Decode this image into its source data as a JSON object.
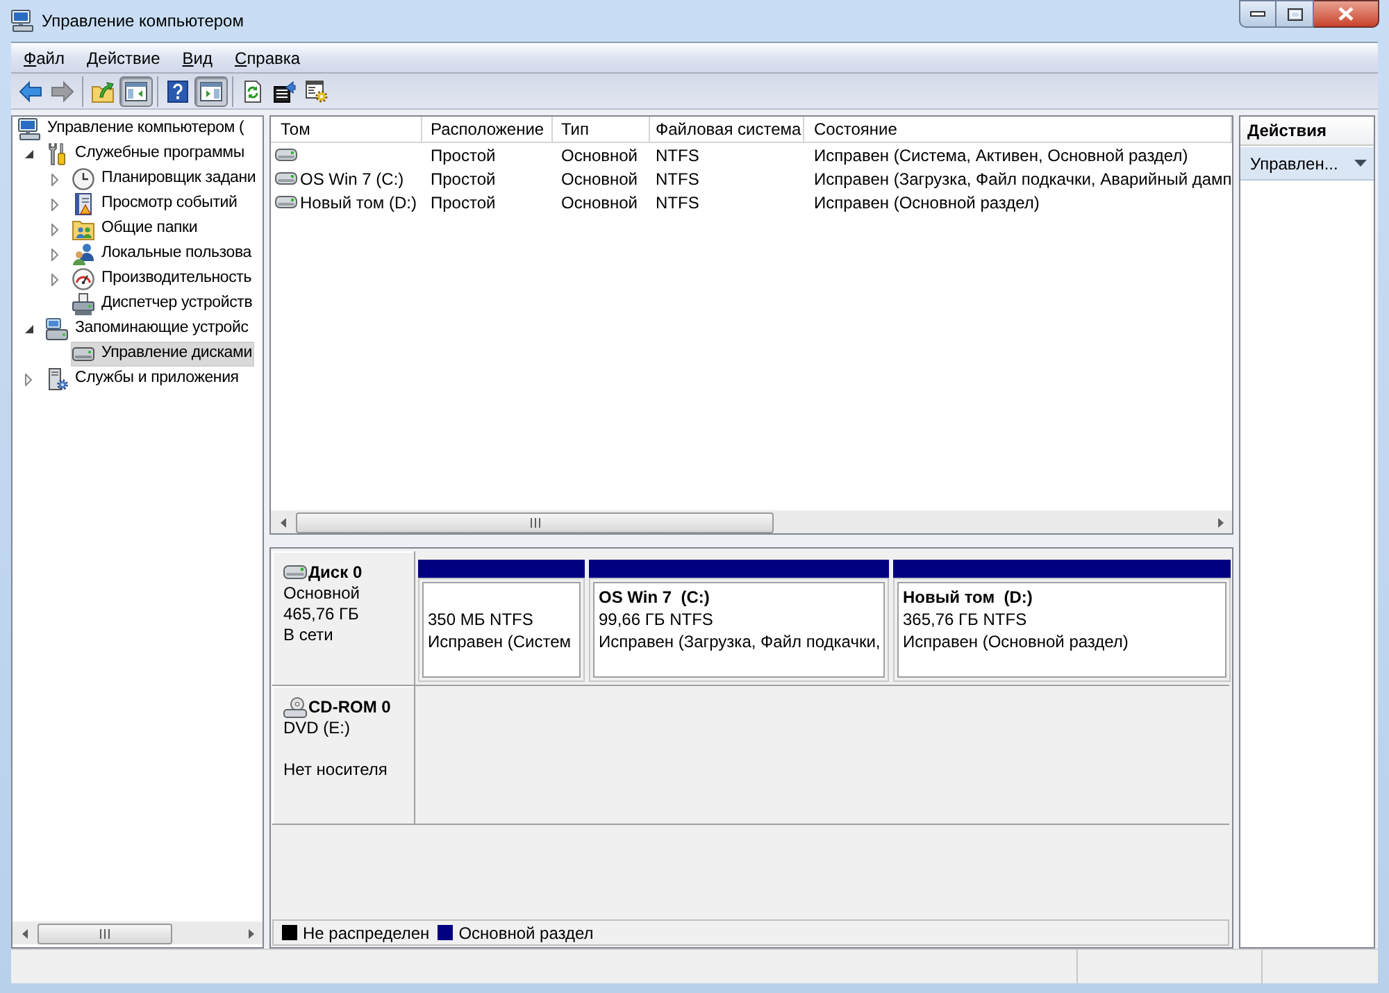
{
  "window": {
    "title": "Управление компьютером"
  },
  "menu": [
    {
      "label": "Файл"
    },
    {
      "label": "Действие"
    },
    {
      "label": "Вид"
    },
    {
      "label": "Справка"
    }
  ],
  "toolbar": [
    [
      {
        "kind": "back",
        "disabled": false,
        "pressed": false
      },
      {
        "kind": "forward",
        "disabled": true,
        "pressed": false
      }
    ],
    [
      {
        "kind": "up",
        "disabled": false,
        "pressed": false
      },
      {
        "kind": "console-tree",
        "disabled": false,
        "pressed": true
      }
    ],
    [
      {
        "kind": "help",
        "disabled": false,
        "pressed": false
      },
      {
        "kind": "action-pane",
        "disabled": false,
        "pressed": true
      }
    ],
    [
      {
        "kind": "refresh",
        "disabled": false,
        "pressed": false
      },
      {
        "kind": "export",
        "disabled": false,
        "pressed": false
      },
      {
        "kind": "properties",
        "disabled": false,
        "pressed": false
      }
    ]
  ],
  "tree": [
    {
      "label": "Управление компьютером (",
      "kind": "root",
      "selected": false,
      "children": [
        {
          "label": "Служебные программы",
          "kind": "tools",
          "expanded": true,
          "selected": false,
          "children": [
            {
              "label": "Планировщик задани",
              "kind": "scheduler",
              "expanded": false,
              "selected": false
            },
            {
              "label": "Просмотр событий",
              "kind": "events",
              "expanded": false,
              "selected": false
            },
            {
              "label": "Общие папки",
              "kind": "shares",
              "expanded": false,
              "selected": false
            },
            {
              "label": "Локальные пользова",
              "kind": "users",
              "expanded": false,
              "selected": false
            },
            {
              "label": "Производительность",
              "kind": "performance",
              "expanded": false,
              "selected": false
            },
            {
              "label": "Диспетчер устройств",
              "kind": "devices",
              "selected": false
            }
          ]
        },
        {
          "label": "Запоминающие устройс",
          "kind": "storage",
          "expanded": true,
          "selected": false,
          "children": [
            {
              "label": "Управление дисками",
              "kind": "disks",
              "selected": true
            }
          ]
        },
        {
          "label": "Службы и приложения",
          "kind": "services",
          "expanded": false,
          "selected": false
        }
      ]
    }
  ],
  "volumes": {
    "columns": [
      "Том",
      "Расположение",
      "Тип",
      "Файловая система",
      "Состояние"
    ],
    "rows": [
      {
        "cells": [
          "",
          "Простой",
          "Основной",
          "NTFS",
          "Исправен (Система, Активен, Основной раздел)"
        ]
      },
      {
        "cells": [
          "OS Win 7 (C:)",
          "Простой",
          "Основной",
          "NTFS",
          "Исправен (Загрузка, Файл подкачки, Аварийный дамп"
        ]
      },
      {
        "cells": [
          "Новый том (D:)",
          "Простой",
          "Основной",
          "NTFS",
          "Исправен (Основной раздел)"
        ]
      }
    ]
  },
  "disks": [
    {
      "name": "Диск 0",
      "kind": "hdd",
      "type": "Основной",
      "size": "465,76 ГБ",
      "status": "В сети",
      "partitions": [
        {
          "size": "350 МБ NTFS",
          "status": "Исправен (Систем"
        },
        {
          "name": "OS Win 7  (C:)",
          "size": "99,66 ГБ NTFS",
          "status": "Исправен (Загрузка, Файл подкачки,"
        },
        {
          "name": "Новый том  (D:)",
          "size": "365,76 ГБ NTFS",
          "status": "Исправен (Основной раздел)"
        }
      ]
    },
    {
      "name": "CD-ROM 0",
      "kind": "cdrom",
      "type": "DVD (E:)",
      "status": "Нет носителя"
    }
  ],
  "legend": [
    {
      "label": "Не распределен",
      "color": "#000000"
    },
    {
      "label": "Основной раздел",
      "color": "#000080"
    }
  ],
  "actions": {
    "title": "Действия",
    "items": [
      {
        "label": "Управлен..."
      }
    ]
  }
}
